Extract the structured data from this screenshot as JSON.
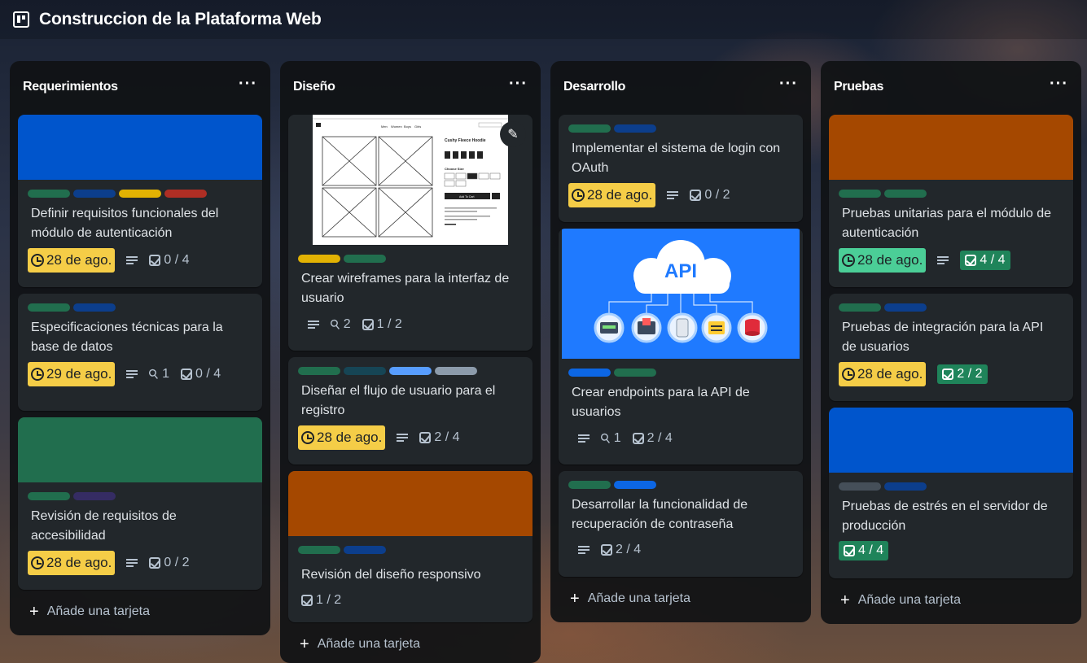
{
  "board": {
    "title": "Construccion de la Plataforma Web",
    "icon": "board-icon"
  },
  "lists": [
    {
      "title": "Requerimientos",
      "add_label": "Añade una tarjeta",
      "cards": [
        {
          "title": "Definir requisitos funcionales del módulo de autenticación",
          "due": "28 de ago.",
          "checklist": "0 / 4"
        },
        {
          "title": "Especificaciones técnicas para la base de datos",
          "due": "29 de ago.",
          "attachments": "1",
          "checklist": "0 / 4"
        },
        {
          "title": "Revisión de requisitos de accesibilidad",
          "due": "28 de ago.",
          "checklist": "0 / 2"
        }
      ]
    },
    {
      "title": "Diseño",
      "add_label": "Añade una tarjeta",
      "cards": [
        {
          "title": "Crear wireframes para la interfaz de usuario",
          "attachments": "2",
          "checklist": "1 / 2",
          "cover_text": {
            "nav1": "Men",
            "nav2": "Women",
            "nav3": "Boys",
            "nav4": "Girls",
            "product": "Cushy Fleece Hoodie",
            "size": "Choose Size",
            "add": "Add To Cart"
          }
        },
        {
          "title": "Diseñar el flujo de usuario para el registro",
          "due": "28 de ago.",
          "checklist": "2 / 4"
        },
        {
          "title": "Revisión del diseño responsivo",
          "checklist": "1 / 2"
        }
      ]
    },
    {
      "title": "Desarrollo",
      "add_label": "Añade una tarjeta",
      "cards": [
        {
          "title": "Implementar el sistema de login con OAuth",
          "due": "28 de ago.",
          "checklist": "0 / 2"
        },
        {
          "title": "Crear endpoints para la API de usuarios",
          "attachments": "1",
          "checklist": "2 / 4",
          "cover_text": "API"
        },
        {
          "title": "Desarrollar la funcionalidad de recuperación de contraseña",
          "checklist": "2 / 4"
        }
      ]
    },
    {
      "title": "Pruebas",
      "add_label": "Añade una tarjeta",
      "cards": [
        {
          "title": "Pruebas unitarias para el módulo de autenticación",
          "due": "28 de ago.",
          "checklist": "4 / 4"
        },
        {
          "title": "Pruebas de integración para la API de usuarios",
          "due": "28 de ago.",
          "checklist": "2 / 2"
        },
        {
          "title": "Pruebas de estrés en el servidor de producción",
          "checklist": "4 / 4"
        }
      ]
    }
  ],
  "colors": {
    "label_green": "#216e4e",
    "label_blue": "#0c3e8c",
    "label_yellow": "#e2b203",
    "label_red": "#ae2e24",
    "label_purple": "#352c63",
    "label_teal": "#164555",
    "label_lightblue": "#579dff",
    "label_gray": "#8c9bab",
    "label_darkgray": "#454f59",
    "label_brightblue": "#0c66e4",
    "cover_blue": "#0055cc",
    "cover_green": "#216e4e",
    "cover_orange": "#a54800",
    "cover_api": "#1f7aff",
    "due_yellow": "#f5cd47",
    "due_green": "#4bce97"
  }
}
